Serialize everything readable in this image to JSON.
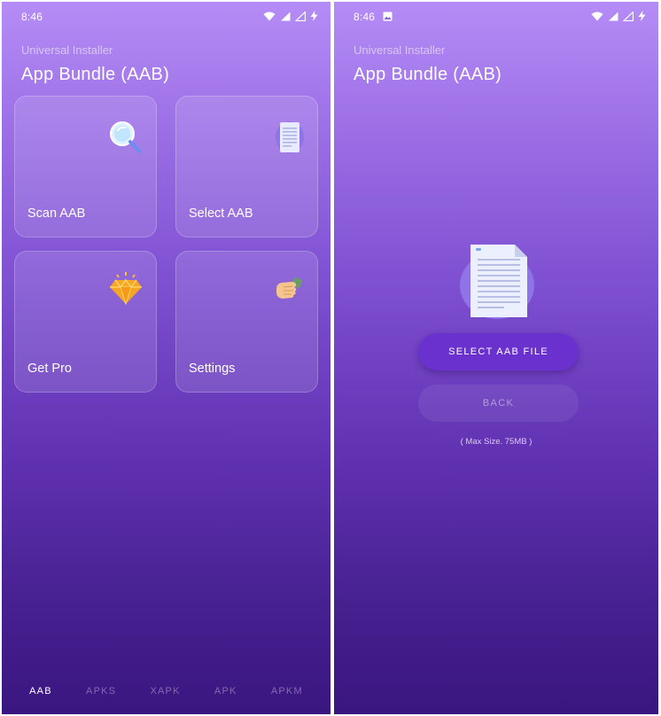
{
  "left": {
    "status": {
      "time": "8:46"
    },
    "header": {
      "subtitle": "Universal Installer",
      "title": "App Bundle (AAB)"
    },
    "cards": [
      {
        "label": "Scan AAB",
        "icon": "magnifier-icon"
      },
      {
        "label": "Select AAB",
        "icon": "document-icon"
      },
      {
        "label": "Get Pro",
        "icon": "diamond-icon"
      },
      {
        "label": "Settings",
        "icon": "hand-icon"
      }
    ],
    "nav": {
      "tabs": [
        "AAB",
        "APKS",
        "XAPK",
        "APK",
        "APKM"
      ],
      "active": "AAB"
    }
  },
  "right": {
    "status": {
      "time": "8:46"
    },
    "header": {
      "subtitle": "Universal Installer",
      "title": "App Bundle (AAB)"
    },
    "select_button": "SELECT AAB FILE",
    "back_button": "BACK",
    "max_size": "( Max Size. 75MB )"
  },
  "colors": {
    "gradient_top": "#b58cf6",
    "gradient_bottom": "#3a1680",
    "primary_button": "#6a31cf",
    "diamond": "#f6a623"
  }
}
